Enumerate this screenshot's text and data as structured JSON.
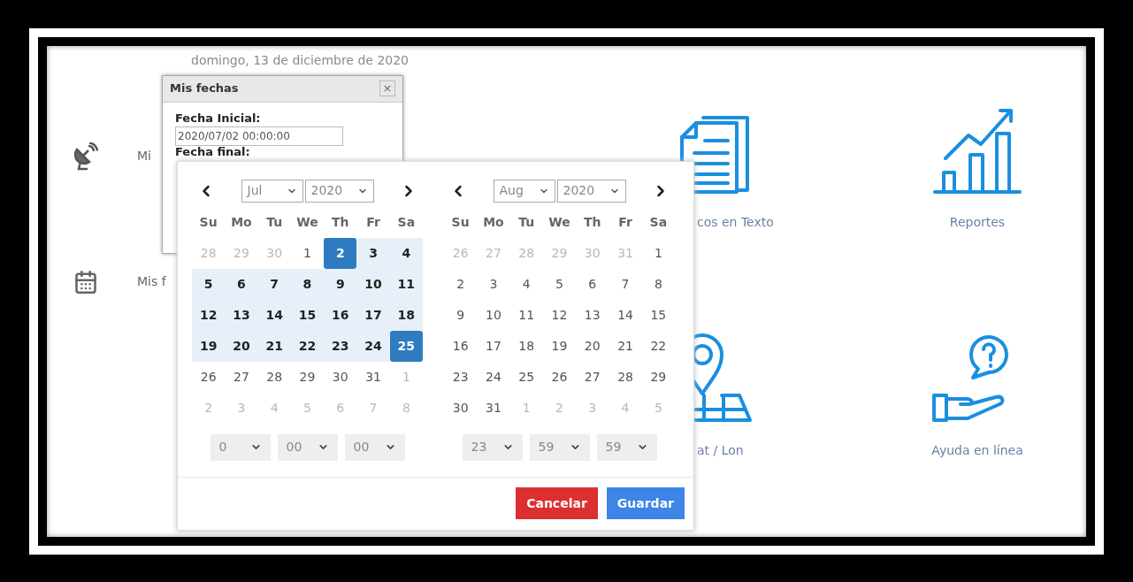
{
  "date_line": "domingo, 13 de diciembre de 2020",
  "menu": [
    {
      "kind": "satellite",
      "label": "Mi"
    },
    {
      "kind": "calendar",
      "label": "Mis f"
    }
  ],
  "tiles": [
    {
      "kind": "documents",
      "label": "cos en Texto"
    },
    {
      "kind": "chart",
      "label": "Reportes"
    },
    {
      "kind": "map",
      "label": "at / Lon"
    },
    {
      "kind": "help",
      "label": "Ayuda en línea"
    }
  ],
  "dialog": {
    "title": "Mis fechas",
    "close": "×",
    "start_label": "Fecha Inicial:",
    "start_value": "2020/07/02 00:00:00",
    "end_label": "Fecha final:"
  },
  "picker": {
    "months": [
      {
        "month": "Jul",
        "year": "2020",
        "weekdays": [
          "Su",
          "Mo",
          "Tu",
          "We",
          "Th",
          "Fr",
          "Sa"
        ],
        "time": [
          "0",
          "00",
          "00"
        ],
        "weeks": [
          [
            {
              "d": "28",
              "kind": "off"
            },
            {
              "d": "29",
              "kind": "off"
            },
            {
              "d": "30",
              "kind": "off"
            },
            {
              "d": "1",
              "kind": "normal"
            },
            {
              "d": "2",
              "kind": "selected"
            },
            {
              "d": "3",
              "kind": "range"
            },
            {
              "d": "4",
              "kind": "range"
            }
          ],
          [
            {
              "d": "5",
              "kind": "range"
            },
            {
              "d": "6",
              "kind": "range"
            },
            {
              "d": "7",
              "kind": "range"
            },
            {
              "d": "8",
              "kind": "range"
            },
            {
              "d": "9",
              "kind": "range"
            },
            {
              "d": "10",
              "kind": "range"
            },
            {
              "d": "11",
              "kind": "range"
            }
          ],
          [
            {
              "d": "12",
              "kind": "range"
            },
            {
              "d": "13",
              "kind": "range"
            },
            {
              "d": "14",
              "kind": "range"
            },
            {
              "d": "15",
              "kind": "range"
            },
            {
              "d": "16",
              "kind": "range"
            },
            {
              "d": "17",
              "kind": "range"
            },
            {
              "d": "18",
              "kind": "range"
            }
          ],
          [
            {
              "d": "19",
              "kind": "range"
            },
            {
              "d": "20",
              "kind": "range"
            },
            {
              "d": "21",
              "kind": "range"
            },
            {
              "d": "22",
              "kind": "range"
            },
            {
              "d": "23",
              "kind": "range"
            },
            {
              "d": "24",
              "kind": "range"
            },
            {
              "d": "25",
              "kind": "selected"
            }
          ],
          [
            {
              "d": "26",
              "kind": "normal"
            },
            {
              "d": "27",
              "kind": "normal"
            },
            {
              "d": "28",
              "kind": "normal"
            },
            {
              "d": "29",
              "kind": "normal"
            },
            {
              "d": "30",
              "kind": "normal"
            },
            {
              "d": "31",
              "kind": "normal"
            },
            {
              "d": "1",
              "kind": "off"
            }
          ],
          [
            {
              "d": "2",
              "kind": "off"
            },
            {
              "d": "3",
              "kind": "off"
            },
            {
              "d": "4",
              "kind": "off"
            },
            {
              "d": "5",
              "kind": "off"
            },
            {
              "d": "6",
              "kind": "off"
            },
            {
              "d": "7",
              "kind": "off"
            },
            {
              "d": "8",
              "kind": "off"
            }
          ]
        ]
      },
      {
        "month": "Aug",
        "year": "2020",
        "weekdays": [
          "Su",
          "Mo",
          "Tu",
          "We",
          "Th",
          "Fr",
          "Sa"
        ],
        "time": [
          "23",
          "59",
          "59"
        ],
        "weeks": [
          [
            {
              "d": "26",
              "kind": "off"
            },
            {
              "d": "27",
              "kind": "off"
            },
            {
              "d": "28",
              "kind": "off"
            },
            {
              "d": "29",
              "kind": "off"
            },
            {
              "d": "30",
              "kind": "off"
            },
            {
              "d": "31",
              "kind": "off"
            },
            {
              "d": "1",
              "kind": "normal"
            }
          ],
          [
            {
              "d": "2",
              "kind": "normal"
            },
            {
              "d": "3",
              "kind": "normal"
            },
            {
              "d": "4",
              "kind": "normal"
            },
            {
              "d": "5",
              "kind": "normal"
            },
            {
              "d": "6",
              "kind": "normal"
            },
            {
              "d": "7",
              "kind": "normal"
            },
            {
              "d": "8",
              "kind": "normal"
            }
          ],
          [
            {
              "d": "9",
              "kind": "normal"
            },
            {
              "d": "10",
              "kind": "normal"
            },
            {
              "d": "11",
              "kind": "normal"
            },
            {
              "d": "12",
              "kind": "normal"
            },
            {
              "d": "13",
              "kind": "normal"
            },
            {
              "d": "14",
              "kind": "normal"
            },
            {
              "d": "15",
              "kind": "normal"
            }
          ],
          [
            {
              "d": "16",
              "kind": "normal"
            },
            {
              "d": "17",
              "kind": "normal"
            },
            {
              "d": "18",
              "kind": "normal"
            },
            {
              "d": "19",
              "kind": "normal"
            },
            {
              "d": "20",
              "kind": "normal"
            },
            {
              "d": "21",
              "kind": "normal"
            },
            {
              "d": "22",
              "kind": "normal"
            }
          ],
          [
            {
              "d": "23",
              "kind": "normal"
            },
            {
              "d": "24",
              "kind": "normal"
            },
            {
              "d": "25",
              "kind": "normal"
            },
            {
              "d": "26",
              "kind": "normal"
            },
            {
              "d": "27",
              "kind": "normal"
            },
            {
              "d": "28",
              "kind": "normal"
            },
            {
              "d": "29",
              "kind": "normal"
            }
          ],
          [
            {
              "d": "30",
              "kind": "normal"
            },
            {
              "d": "31",
              "kind": "normal"
            },
            {
              "d": "1",
              "kind": "off"
            },
            {
              "d": "2",
              "kind": "off"
            },
            {
              "d": "3",
              "kind": "off"
            },
            {
              "d": "4",
              "kind": "off"
            },
            {
              "d": "5",
              "kind": "off"
            }
          ]
        ]
      }
    ],
    "buttons": [
      {
        "kind": "cancel",
        "label": "Cancelar"
      },
      {
        "kind": "save",
        "label": "Guardar"
      }
    ]
  }
}
